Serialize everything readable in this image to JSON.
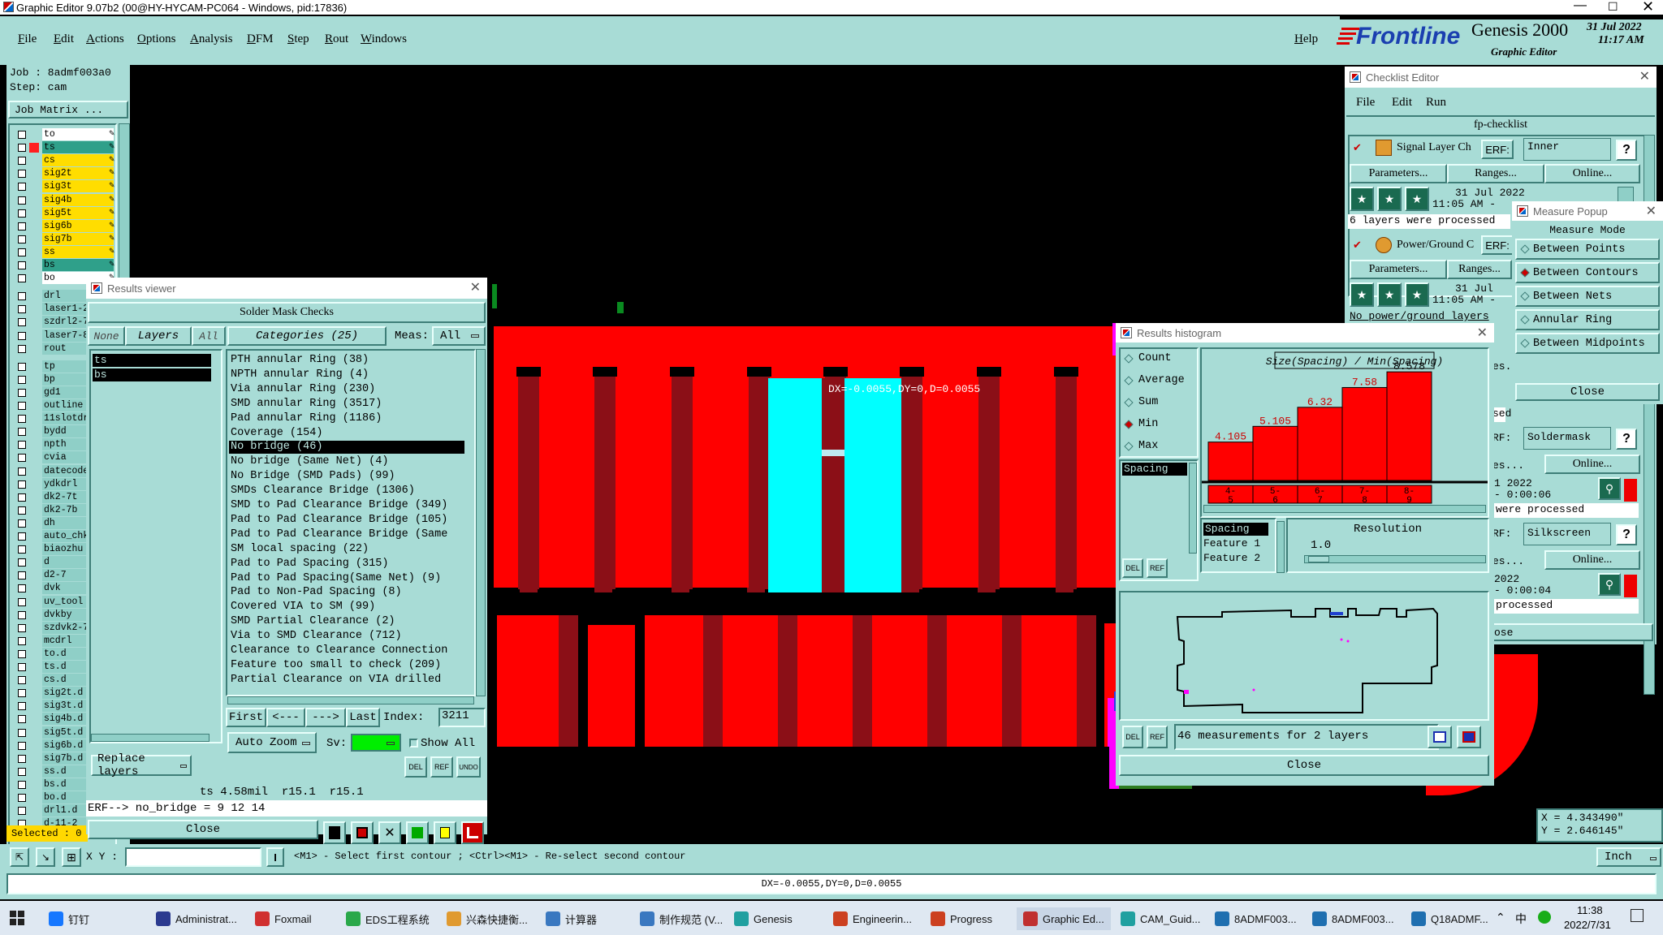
{
  "window": {
    "title": "Graphic Editor 9.07b2 (00@HY-HYCAM-PC064 - Windows, pid:17836)"
  },
  "menu": {
    "items": [
      "File",
      "Edit",
      "Actions",
      "Options",
      "Analysis",
      "DFM",
      "Step",
      "Rout",
      "Windows"
    ],
    "help": "Help"
  },
  "brand": {
    "logo": "Frontline",
    "product": "Genesis 2000",
    "subtitle": "Graphic Editor",
    "date": "31 Jul 2022",
    "time": "11:17 AM"
  },
  "job": {
    "job_label": "Job : 8admf003a0",
    "step_label": "Step: cam",
    "matrix_button": "Job Matrix ..."
  },
  "layers": [
    {
      "name": "to",
      "color": "#ffffff"
    },
    {
      "name": "ts",
      "color": "#2fa08a",
      "marker": "#ff2020"
    },
    {
      "name": "cs",
      "color": "#ffdd00"
    },
    {
      "name": "sig2t",
      "color": "#ffdd00"
    },
    {
      "name": "sig3t",
      "color": "#ffdd00"
    },
    {
      "name": "sig4b",
      "color": "#ffdd00"
    },
    {
      "name": "sig5t",
      "color": "#ffdd00"
    },
    {
      "name": "sig6b",
      "color": "#ffdd00"
    },
    {
      "name": "sig7b",
      "color": "#ffdd00"
    },
    {
      "name": "ss",
      "color": "#ffdd00"
    },
    {
      "name": "bs",
      "color": "#2fa08a"
    },
    {
      "name": "bo",
      "color": "#ffffff"
    },
    {
      "name": "drl",
      "color": "#8fcfc7"
    },
    {
      "name": "laser1-2",
      "color": "#8fcfc7"
    },
    {
      "name": "szdrl2-7",
      "color": "#8fcfc7"
    },
    {
      "name": "laser7-8",
      "color": "#8fcfc7"
    },
    {
      "name": "rout",
      "color": "#8fcfc7"
    },
    {
      "name": "tp",
      "color": "#8fcfc7"
    },
    {
      "name": "bp",
      "color": "#8fcfc7"
    },
    {
      "name": "gd1",
      "color": "#8fcfc7"
    },
    {
      "name": "outline",
      "color": "#8fcfc7"
    },
    {
      "name": "11slotdr",
      "color": "#8fcfc7"
    },
    {
      "name": "bydd",
      "color": "#8fcfc7"
    },
    {
      "name": "npth",
      "color": "#8fcfc7"
    },
    {
      "name": "cvia",
      "color": "#8fcfc7"
    },
    {
      "name": "datecode",
      "color": "#8fcfc7"
    },
    {
      "name": "ydkdrl",
      "color": "#8fcfc7"
    },
    {
      "name": "dk2-7t",
      "color": "#8fcfc7"
    },
    {
      "name": "dk2-7b",
      "color": "#8fcfc7"
    },
    {
      "name": "dh",
      "color": "#8fcfc7"
    },
    {
      "name": "auto_chk",
      "color": "#8fcfc7"
    },
    {
      "name": "biaozhu",
      "color": "#8fcfc7"
    },
    {
      "name": "d",
      "color": "#8fcfc7"
    },
    {
      "name": "d2-7",
      "color": "#8fcfc7"
    },
    {
      "name": "dvk",
      "color": "#8fcfc7"
    },
    {
      "name": "uv_tool",
      "color": "#8fcfc7"
    },
    {
      "name": "dvkby",
      "color": "#8fcfc7"
    },
    {
      "name": "szdvk2-7",
      "color": "#8fcfc7"
    },
    {
      "name": "mcdrl",
      "color": "#8fcfc7"
    },
    {
      "name": "to.d",
      "color": "#8fcfc7"
    },
    {
      "name": "ts.d",
      "color": "#8fcfc7"
    },
    {
      "name": "cs.d",
      "color": "#8fcfc7"
    },
    {
      "name": "sig2t.d",
      "color": "#8fcfc7"
    },
    {
      "name": "sig3t.d",
      "color": "#8fcfc7"
    },
    {
      "name": "sig4b.d",
      "color": "#8fcfc7"
    },
    {
      "name": "sig5t.d",
      "color": "#8fcfc7"
    },
    {
      "name": "sig6b.d",
      "color": "#8fcfc7"
    },
    {
      "name": "sig7b.d",
      "color": "#8fcfc7"
    },
    {
      "name": "ss.d",
      "color": "#8fcfc7"
    },
    {
      "name": "bs.d",
      "color": "#8fcfc7"
    },
    {
      "name": "bo.d",
      "color": "#8fcfc7"
    },
    {
      "name": "drl1.d",
      "color": "#8fcfc7"
    },
    {
      "name": "d-11-2",
      "color": "#8fcfc7"
    }
  ],
  "selected_label": "Selected : 0",
  "canvas": {
    "measure_text": "DX=-0.0055,DY=0,D=0.0055"
  },
  "results_viewer": {
    "title": "Results viewer",
    "header": "Solder Mask Checks",
    "none_btn": "None",
    "layers_btn": "Layers",
    "all_btn": "All",
    "layer_items": [
      "ts",
      "bs"
    ],
    "categories_btn": "Categories (25)",
    "meas_label": "Meas:",
    "meas_value": "All",
    "categories": [
      "PTH annular Ring (38)",
      "NPTH annular Ring (4)",
      "Via annular Ring (230)",
      "SMD annular Ring (3517)",
      "Pad annular Ring (1186)",
      "Coverage (154)",
      "No bridge (46)",
      "No bridge (Same Net) (4)",
      "No Bridge (SMD Pads) (99)",
      "SMDs Clearance Bridge (1306)",
      "SMD to Pad Clearance Bridge (349)",
      "Pad to Pad Clearance Bridge (105)",
      "Pad to Pad Clearance Bridge (Same",
      "SM local spacing (22)",
      "Pad to Pad Spacing (315)",
      "Pad to Pad Spacing(Same Net) (9)",
      "Pad to Non-Pad Spacing (8)",
      "Covered VIA to SM (99)",
      "SMD Partial Clearance (2)",
      "Via to SMD Clearance (712)",
      "Clearance to Clearance Connection",
      "Feature too small to check (209)",
      "Partial Clearance on VIA drilled"
    ],
    "selected_index": 6,
    "first_btn": "First",
    "prev_btn": "<---",
    "next_btn": "--->",
    "last_btn": "Last",
    "index_label": "Index:",
    "index_value": "3211",
    "auto_zoom": "Auto Zoom",
    "sv_label": "Sv:",
    "show_all": "Show All",
    "replace_layers": "Replace layers",
    "info_line": "ts 4.58mil  r15.1  r15.1",
    "erf_line": "ERF--> no_bridge = 9 12 14",
    "close": "Close"
  },
  "histogram": {
    "title": "Results histogram",
    "options": [
      "Count",
      "Average",
      "Sum",
      "Min",
      "Max"
    ],
    "selected_option": "Min",
    "list_item": "Spacing",
    "chart_title": "Size(Spacing) / Min(Spacing)",
    "legend": [
      "Spacing",
      "Feature 1",
      "Feature 2"
    ],
    "resolution_label": "Resolution",
    "resolution_value": "1.0",
    "summary": "46 measurements for 2 layers",
    "close": "Close"
  },
  "chart_data": {
    "type": "bar",
    "title": "Size(Spacing) / Min(Spacing)",
    "categories": [
      "4-5",
      "5-6",
      "6-7",
      "7-8",
      "8-9"
    ],
    "values": [
      4.105,
      5.105,
      6.32,
      7.58,
      8.578
    ],
    "value_labels": [
      "4.105",
      "5.105",
      "6.32",
      "7.58",
      "8.578"
    ],
    "bin_labels": [
      [
        "4-",
        "5"
      ],
      [
        "5-",
        "6"
      ],
      [
        "6-",
        "7"
      ],
      [
        "7-",
        "8"
      ],
      [
        "8-",
        "9"
      ]
    ],
    "ylim": [
      0,
      9
    ],
    "bar_color": "#ff0000"
  },
  "checklist": {
    "title": "Checklist Editor",
    "menu": [
      "File",
      "Edit",
      "Run"
    ],
    "name": "fp-checklist",
    "item1": {
      "name": "Signal Layer Ch",
      "erf_label": "ERF:",
      "erf_value": "Inner",
      "params": "Parameters...",
      "ranges": "Ranges...",
      "online": "Online...",
      "date": "31 Jul 2022",
      "time": "11:05 AM -",
      "status": "6 layers were processed"
    },
    "item2": {
      "name": "Power/Ground C",
      "erf_label": "ERF:",
      "params": "Parameters...",
      "ranges": "Ranges...",
      "date": "31 Jul",
      "time": "11:05 AM -",
      "status": "No power/ground layers"
    },
    "item3": {
      "status_partial": "sed",
      "erf_label": "RF:",
      "erf_value": "Soldermask",
      "ranges_partial": "es...",
      "online": "Online...",
      "date": "1 2022",
      "time": "- 0:00:06",
      "status": "were processed"
    },
    "item4": {
      "erf_label": "RF:",
      "erf_value": "Silkscreen",
      "ranges_partial": "es...",
      "online": "Online...",
      "date": "2022",
      "time": "- 0:00:04",
      "status": "processed"
    },
    "close_partial": "ose",
    "help": "?",
    "partial_left": "es..."
  },
  "measure_popup": {
    "title": "Measure Popup",
    "mode_label": "Measure Mode",
    "modes": [
      "Between Points",
      "Between Contours",
      "Between Nets",
      "Annular Ring",
      "Between Midpoints"
    ],
    "selected": "Between Contours",
    "close": "Close"
  },
  "coords": {
    "x": "X = 4.343490\"",
    "y": "Y = 2.646145\""
  },
  "statusbar": {
    "xy_label": "X Y :",
    "hint": "<M1> - Select first contour ; <Ctrl><M1> - Re-select second contour",
    "units": "Inch",
    "measure": "DX=-0.0055,DY=0,D=0.0055"
  },
  "taskbar": {
    "items": [
      "钉钉",
      "Administrat...",
      "Foxmail",
      "EDS工程系统",
      "兴森快捷衡...",
      "计算器",
      "制作规范 (V...",
      "Genesis",
      "Engineerin...",
      "Progress",
      "Graphic Ed...",
      "CAM_Guid...",
      "8ADMF003...",
      "8ADMF003...",
      "Q18ADMF..."
    ],
    "ime": "中",
    "time": "11:38",
    "date": "2022/7/31"
  }
}
